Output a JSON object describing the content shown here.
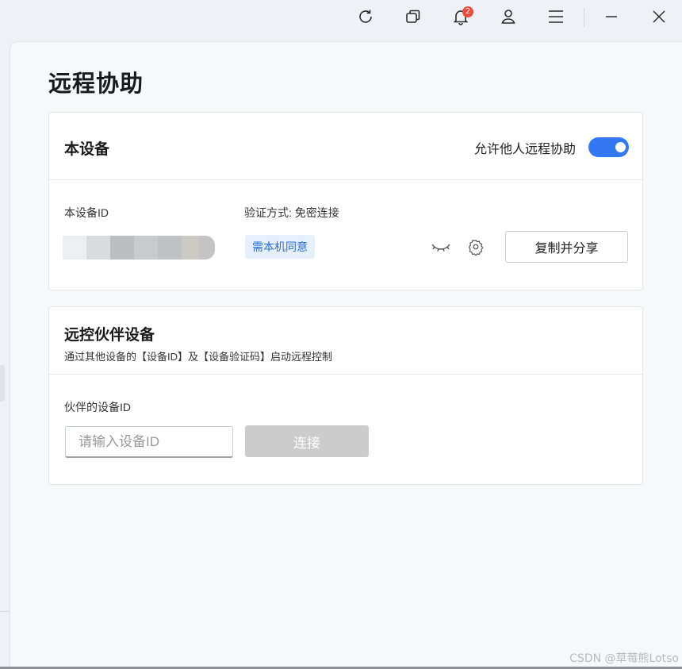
{
  "toolbar": {
    "icons": [
      "refresh-icon",
      "windows-icon",
      "bell-icon",
      "user-icon",
      "menu-icon",
      "minimize-icon",
      "close-icon"
    ],
    "notification_count": "2"
  },
  "page": {
    "title": "远程协助"
  },
  "this_device": {
    "title": "本设备",
    "allow_label": "允许他人远程协助",
    "allow_enabled": true,
    "id_label": "本设备ID",
    "verify_label": "验证方式: 免密连接",
    "consent_tag": "需本机同意",
    "share_button": "复制并分享"
  },
  "partner": {
    "title": "远控伙伴设备",
    "subtitle": "通过其他设备的【设备ID】及【设备验证码】启动远程控制",
    "id_label": "伙伴的设备ID",
    "input_placeholder": "请输入设备ID",
    "input_value": "",
    "connect_button": "连接"
  },
  "watermark": "CSDN @草莓熊Lotso",
  "colors": {
    "accent": "#3478f6",
    "tag_bg": "#e6f0fd",
    "tag_text": "#2a6fd6",
    "disabled": "#cccccc"
  }
}
